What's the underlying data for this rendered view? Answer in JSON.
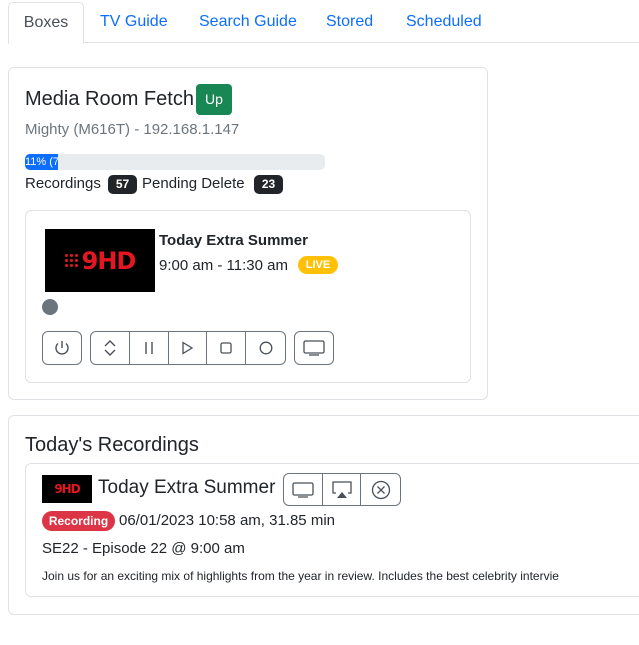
{
  "tabs": [
    {
      "label": "Boxes",
      "active": true
    },
    {
      "label": "TV Guide"
    },
    {
      "label": "Search Guide"
    },
    {
      "label": "Stored"
    },
    {
      "label": "Scheduled"
    }
  ],
  "box": {
    "name": "Media Room Fetch",
    "status": "Up",
    "device": "Mighty (M616T) - 192.168.1.147",
    "progress": {
      "value": 11,
      "label": "11% (7"
    },
    "recordings_label": "Recordings",
    "recordings_count": "57",
    "pending_label": "Pending Delete",
    "pending_count": "23",
    "now_playing": {
      "title": "Today Extra Summer",
      "time": "9:00 am - 11:30 am",
      "live_badge": "LIVE",
      "channel_logo": "9HD"
    },
    "controls": [
      "power-icon",
      "updown-icon",
      "pause-icon",
      "play-icon",
      "stop-icon",
      "record-icon",
      "tv-icon"
    ]
  },
  "recordings": {
    "title": "Today's Recordings",
    "items": [
      {
        "title": "Today Extra Summer",
        "channel_logo": "9HD",
        "status": "Recording",
        "meta": "06/01/2023 10:58 am, 31.85 min",
        "episode": "SE22 - Episode 22 @ 9:00 am",
        "description": "Join us for an exciting mix of highlights from the year in review. Includes the best celebrity intervie",
        "actions": [
          "tv-icon",
          "airplay-icon",
          "cancel-icon"
        ]
      }
    ]
  },
  "colors": {
    "accent": "#0d6efd",
    "success": "#198754",
    "dark": "#212529",
    "warning": "#ffc107",
    "danger": "#dc3545"
  }
}
